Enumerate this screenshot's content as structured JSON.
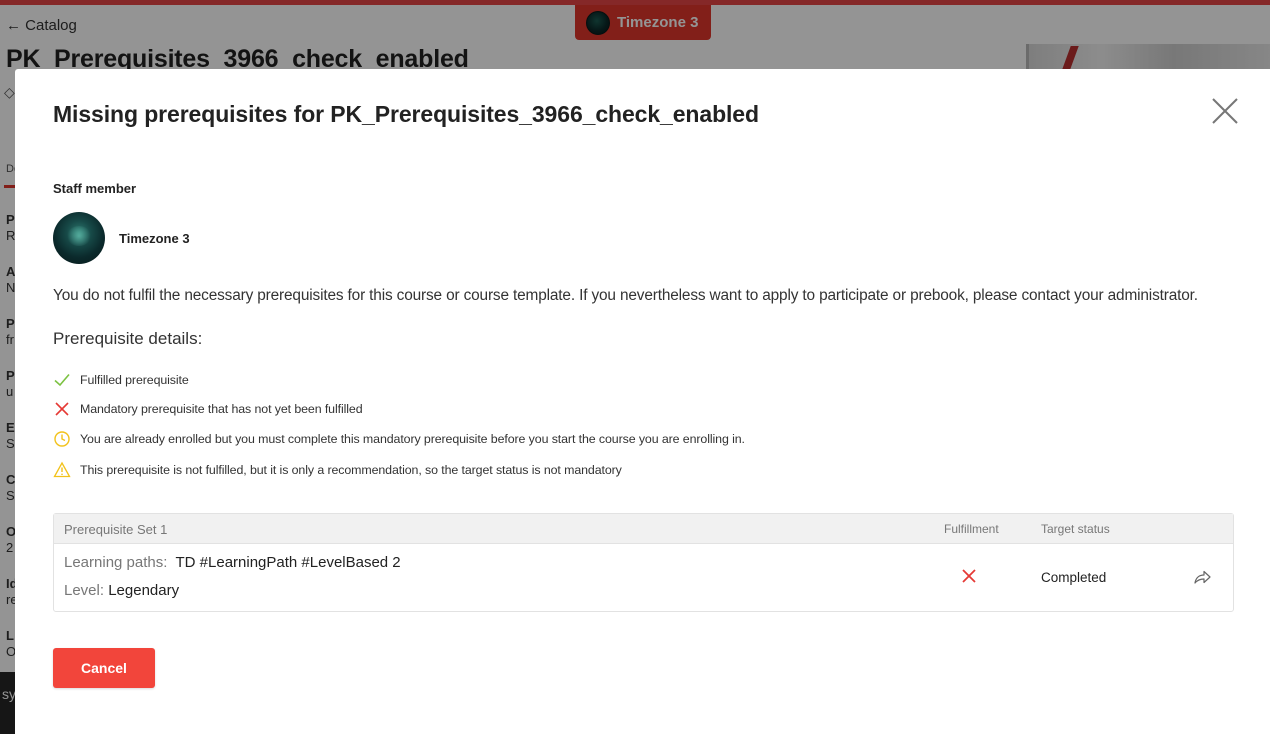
{
  "background": {
    "back_link": "← Catalog",
    "course_title": "PK_Prerequisites_3966_check_enabled",
    "user_chip": {
      "name": "Timezone 3"
    },
    "side_tab": "De",
    "side_fields": [
      {
        "label": "P",
        "value": "R"
      },
      {
        "label": "A",
        "value": "N"
      },
      {
        "label": "P",
        "value": "fr"
      },
      {
        "label": "P",
        "value": "u"
      },
      {
        "label": "E",
        "value": "S"
      },
      {
        "label": "C",
        "value": "S"
      },
      {
        "label": "O",
        "value": "2"
      },
      {
        "label": "Id",
        "value": "re"
      },
      {
        "label": "L",
        "value": "O"
      }
    ],
    "footer_text": "sy"
  },
  "modal": {
    "title": "Missing prerequisites for PK_Prerequisites_3966_check_enabled",
    "staff_label": "Staff member",
    "staff_name": "Timezone 3",
    "notice": "You do not fulfil the necessary prerequisites for this course or course template. If you nevertheless want to apply to participate or prebook, please contact your administrator.",
    "details_heading": "Prerequisite details:",
    "legend": [
      {
        "icon": "checkmark-icon",
        "color": "#7cc242",
        "text": "Fulfilled prerequisite"
      },
      {
        "icon": "cross-icon",
        "color": "#e53935",
        "text": "Mandatory prerequisite that has not yet been fulfilled"
      },
      {
        "icon": "clock-icon",
        "color": "#f2c21b",
        "text": "You are already enrolled but you must complete this mandatory prerequisite before you start the course you are enrolling in."
      },
      {
        "icon": "warning-icon",
        "color": "#f2c21b",
        "text": "This prerequisite is not fulfilled, but it is only a recommendation, so the target status is not mandatory"
      }
    ],
    "table": {
      "set_title": "Prerequisite Set 1",
      "col_fulfilment": "Fulfillment",
      "col_target": "Target status",
      "rows": [
        {
          "path_label": "Learning paths:",
          "path_value": "TD #LearningPath #LevelBased 2",
          "level_label": "Level:",
          "level_value": "Legendary",
          "fulfilment_icon": "cross-icon",
          "target_status": "Completed",
          "action_icon": "share-icon"
        }
      ]
    },
    "cancel_label": "Cancel"
  },
  "colors": {
    "accent": "#f2453b",
    "fulfilled": "#7cc242",
    "not_fulfilled": "#e53935",
    "pending": "#f2c21b"
  }
}
